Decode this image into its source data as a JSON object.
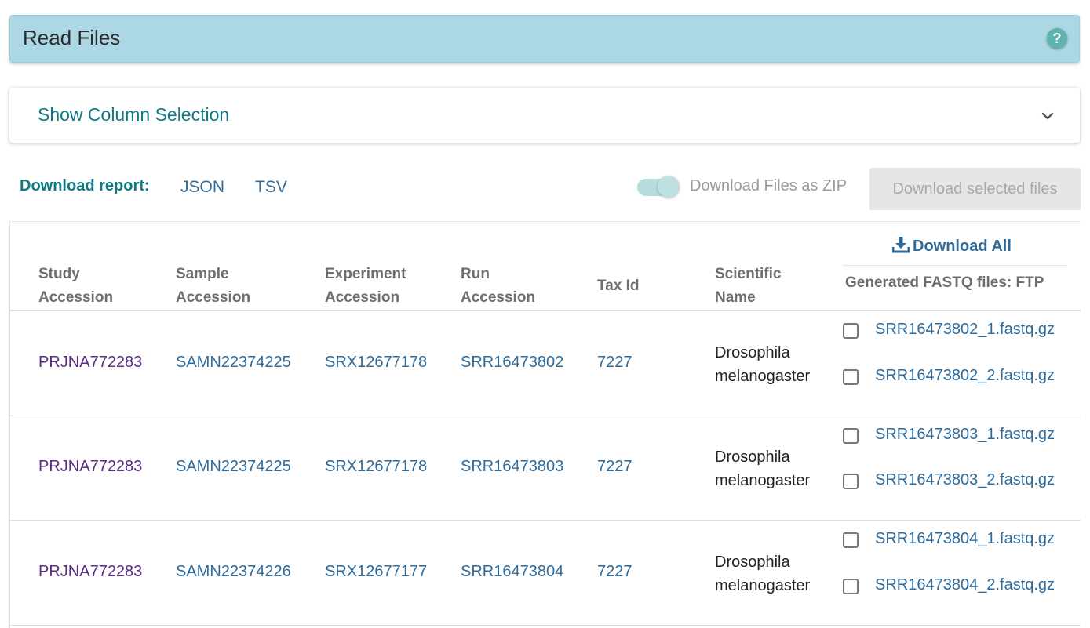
{
  "header": {
    "title": "Read Files",
    "help_glyph": "?"
  },
  "column_selection": {
    "label": "Show Column Selection"
  },
  "report": {
    "label": "Download report:",
    "json": "JSON",
    "tsv": "TSV"
  },
  "zip_toggle": {
    "label": "Download Files as ZIP",
    "enabled": true
  },
  "download_selected_label": "Download selected files",
  "download_all_label": "Download All",
  "columns": {
    "study": [
      "Study",
      "Accession"
    ],
    "sample": [
      "Sample",
      "Accession"
    ],
    "experiment": [
      "Experiment",
      "Accession"
    ],
    "run": [
      "Run",
      "Accession"
    ],
    "tax": "Tax Id",
    "sci": [
      "Scientific",
      "Name"
    ],
    "ftp": "Generated FASTQ files: FTP"
  },
  "rows": [
    {
      "study": "PRJNA772283",
      "sample": "SAMN22374225",
      "experiment": "SRX12677178",
      "run": "SRR16473802",
      "tax": "7227",
      "sci": [
        "Drosophila",
        "melanogaster"
      ],
      "files": [
        "SRR16473802_1.fastq.gz",
        "SRR16473802_2.fastq.gz"
      ]
    },
    {
      "study": "PRJNA772283",
      "sample": "SAMN22374225",
      "experiment": "SRX12677178",
      "run": "SRR16473803",
      "tax": "7227",
      "sci": [
        "Drosophila",
        "melanogaster"
      ],
      "files": [
        "SRR16473803_1.fastq.gz",
        "SRR16473803_2.fastq.gz"
      ]
    },
    {
      "study": "PRJNA772283",
      "sample": "SAMN22374226",
      "experiment": "SRX12677177",
      "run": "SRR16473804",
      "tax": "7227",
      "sci": [
        "Drosophila",
        "melanogaster"
      ],
      "files": [
        "SRR16473804_1.fastq.gz",
        "SRR16473804_2.fastq.gz"
      ]
    }
  ]
}
